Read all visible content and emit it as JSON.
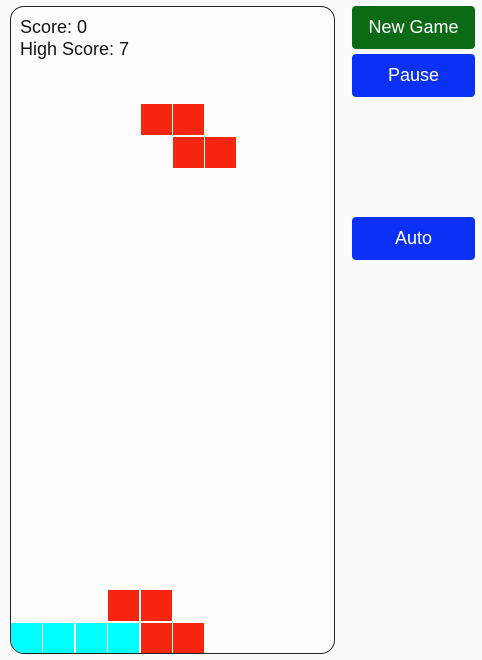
{
  "score": {
    "label": "Score: 0",
    "high_label": "High Score: 7"
  },
  "controls": {
    "new_game": "New Game",
    "pause": "Pause",
    "auto": "Auto"
  },
  "colors": {
    "red": "#f5250f",
    "cyan": "#00ffff",
    "new_game": "#0a6b14",
    "action": "#0a31f5"
  },
  "board": {
    "columns": 10,
    "rows": 20,
    "active_piece": {
      "shape": "Z",
      "color": "red",
      "cells": [
        [
          4,
          3
        ],
        [
          5,
          3
        ],
        [
          5,
          4
        ],
        [
          6,
          4
        ]
      ]
    },
    "locked_cells": [
      {
        "col": 0,
        "row": 19,
        "color": "cyan"
      },
      {
        "col": 1,
        "row": 19,
        "color": "cyan"
      },
      {
        "col": 2,
        "row": 19,
        "color": "cyan"
      },
      {
        "col": 3,
        "row": 19,
        "color": "cyan"
      },
      {
        "col": 3,
        "row": 18,
        "color": "red"
      },
      {
        "col": 4,
        "row": 18,
        "color": "red"
      },
      {
        "col": 4,
        "row": 19,
        "color": "red"
      },
      {
        "col": 5,
        "row": 19,
        "color": "red"
      }
    ]
  }
}
